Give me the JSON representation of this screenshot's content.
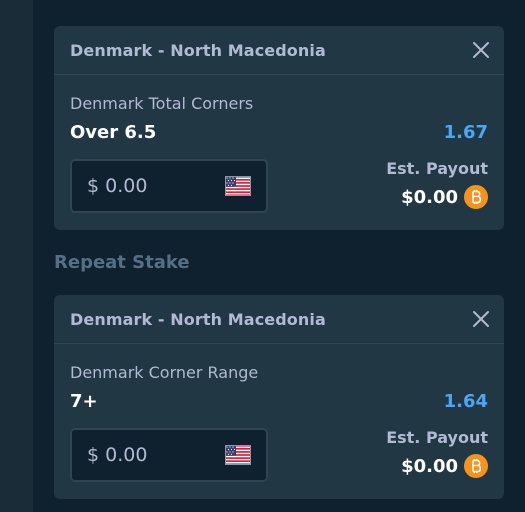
{
  "bets": [
    {
      "match": "Denmark - North Macedonia",
      "market": "Denmark Total Corners",
      "selection": "Over 6.5",
      "odds": "1.67",
      "stake_placeholder": "$ 0.00",
      "currency_icon": "us-flag-icon",
      "payout_label": "Est. Payout",
      "payout_value": "$0.00",
      "payout_currency_icon": "bitcoin-icon"
    },
    {
      "match": "Denmark - North Macedonia",
      "market": "Denmark Corner Range",
      "selection": "7+",
      "odds": "1.64",
      "stake_placeholder": "$ 0.00",
      "currency_icon": "us-flag-icon",
      "payout_label": "Est. Payout",
      "payout_value": "$0.00",
      "payout_currency_icon": "bitcoin-icon"
    }
  ],
  "repeat_stake_label": "Repeat Stake",
  "colors": {
    "background": "#1a2c38",
    "panel": "#0f212e",
    "card": "#213743",
    "odds": "#4da6f5",
    "bitcoin": "#f7931a"
  }
}
